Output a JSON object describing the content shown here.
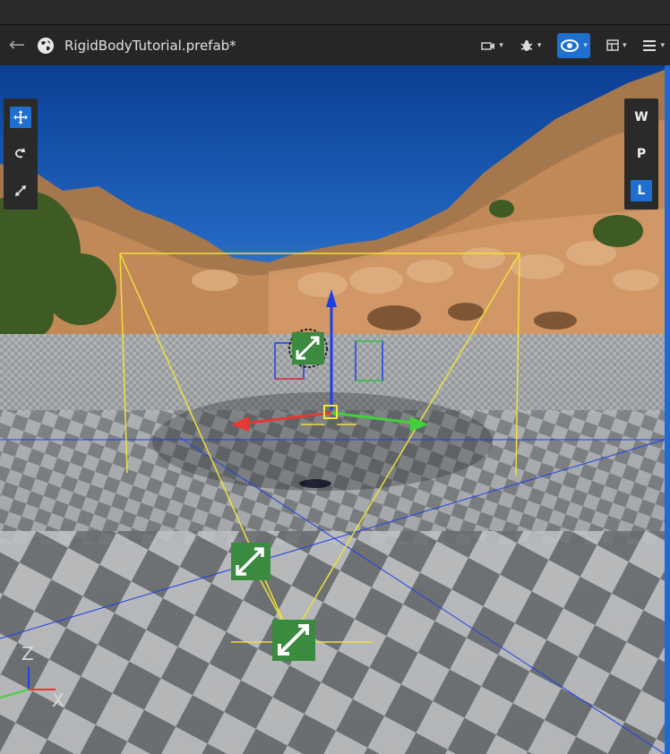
{
  "window": {
    "tab_title": "RigidBodyTutorial.prefab*"
  },
  "toolbar": {
    "items": [
      "camera-menu",
      "debug-menu",
      "view-mode-menu",
      "layout-menu",
      "main-menu"
    ],
    "active": "view-mode-menu"
  },
  "gizmo_tools": [
    "move",
    "rotate",
    "scale"
  ],
  "gizmo_active": "move",
  "space_modes": {
    "world": "W",
    "parent": "P",
    "local": "L",
    "active": "L"
  },
  "axis_indicator": {
    "z": "Z",
    "x": "X"
  },
  "colors": {
    "accent": "#1f6fd1",
    "selection": "#f5e43c",
    "x_axis": "#e53935",
    "y_axis": "#43d13b",
    "z_axis": "#1e3ef0",
    "icon_green": "#3a8a3f"
  }
}
